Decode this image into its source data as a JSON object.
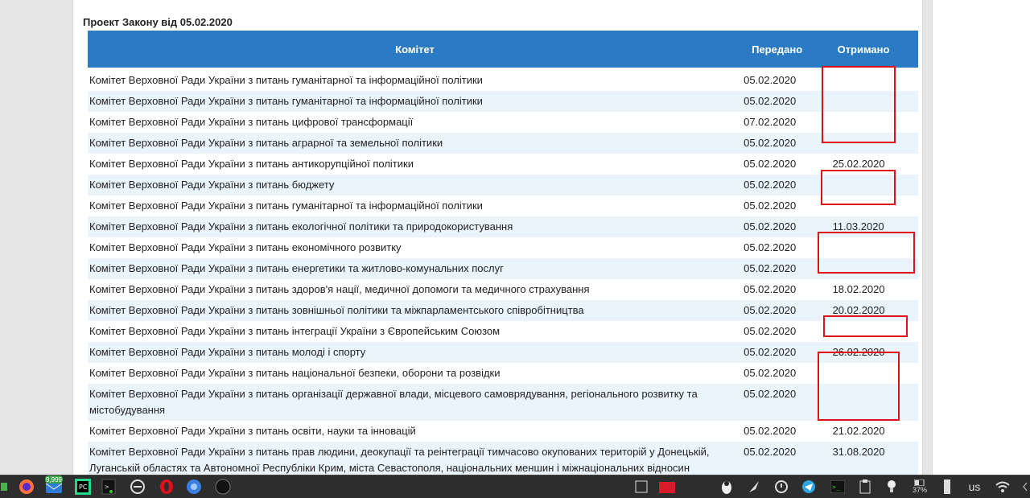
{
  "heading": "Проект Закону від 05.02.2020",
  "table": {
    "headers": {
      "committee": "Комітет",
      "sent": "Передано",
      "received": "Отримано"
    },
    "rows": [
      {
        "committee": "Комітет Верховної Ради України з питань гуманітарної та інформаційної політики",
        "sent": "05.02.2020",
        "received": ""
      },
      {
        "committee": "Комітет Верховної Ради України з питань гуманітарної та інформаційної політики",
        "sent": "05.02.2020",
        "received": ""
      },
      {
        "committee": "Комітет Верховної Ради України з питань цифрової трансформації",
        "sent": "07.02.2020",
        "received": ""
      },
      {
        "committee": "Комітет Верховної Ради України з питань аграрної та земельної політики",
        "sent": "05.02.2020",
        "received": ""
      },
      {
        "committee": "Комітет Верховної Ради України з питань антикорупційної політики",
        "sent": "05.02.2020",
        "received": "25.02.2020"
      },
      {
        "committee": "Комітет Верховної Ради України з питань бюджету",
        "sent": "05.02.2020",
        "received": ""
      },
      {
        "committee": "Комітет Верховної Ради України з питань гуманітарної та інформаційної політики",
        "sent": "05.02.2020",
        "received": ""
      },
      {
        "committee": "Комітет Верховної Ради України з питань екологічної політики та природокористування",
        "sent": "05.02.2020",
        "received": "11.03.2020"
      },
      {
        "committee": "Комітет Верховної Ради України з питань економічного розвитку",
        "sent": "05.02.2020",
        "received": ""
      },
      {
        "committee": "Комітет Верховної Ради України з питань енергетики та житлово-комунальних послуг",
        "sent": "05.02.2020",
        "received": ""
      },
      {
        "committee": "Комітет Верховної Ради України з питань здоров'я нації, медичної допомоги та медичного страхування",
        "sent": "05.02.2020",
        "received": "18.02.2020"
      },
      {
        "committee": "Комітет Верховної Ради України з питань зовнішньої політики та міжпарламентського співробітництва",
        "sent": "05.02.2020",
        "received": "20.02.2020"
      },
      {
        "committee": "Комітет Верховної Ради України з питань інтеграції України з Європейським Союзом",
        "sent": "05.02.2020",
        "received": ""
      },
      {
        "committee": "Комітет Верховної Ради України з питань молоді і спорту",
        "sent": "05.02.2020",
        "received": "26.02.2020"
      },
      {
        "committee": "Комітет Верховної Ради України з питань національної безпеки, оборони та розвідки",
        "sent": "05.02.2020",
        "received": ""
      },
      {
        "committee": "Комітет Верховної Ради України з питань організації державної влади, місцевого самоврядування, регіонального розвитку та містобудування",
        "sent": "05.02.2020",
        "received": ""
      },
      {
        "committee": "Комітет Верховної Ради України з питань освіти, науки та інновацій",
        "sent": "05.02.2020",
        "received": "21.02.2020"
      },
      {
        "committee": "Комітет Верховної Ради України з питань прав людини, деокупації та реінтеграції тимчасово окупованих територій у Донецькій, Луганській областях та Автономної Республіки Крим, міста Севастополя, національних меншин і міжнаціональних відносин",
        "sent": "05.02.2020",
        "received": "31.08.2020"
      }
    ]
  },
  "taskbar": {
    "badge": "9,999",
    "battery": "37%",
    "keyboard_layout": "us",
    "icons": [
      "app-icon",
      "firefox-icon",
      "mail-icon",
      "pycharm-icon",
      "terminal-icon",
      "network-tool-icon",
      "opera-icon",
      "chrome-icon",
      "obs-icon",
      "show-desktop-icon",
      "folder-icon",
      "tux-icon",
      "feather-icon",
      "update-icon",
      "telegram-icon",
      "terminal-tray-icon",
      "clipboard-icon",
      "bulb-icon",
      "battery-icon",
      "usb-icon",
      "wifi-icon"
    ]
  },
  "colors": {
    "header": "#2b7bc4",
    "row_alt": "#eaf4fc",
    "highlight": "#e0101a"
  }
}
